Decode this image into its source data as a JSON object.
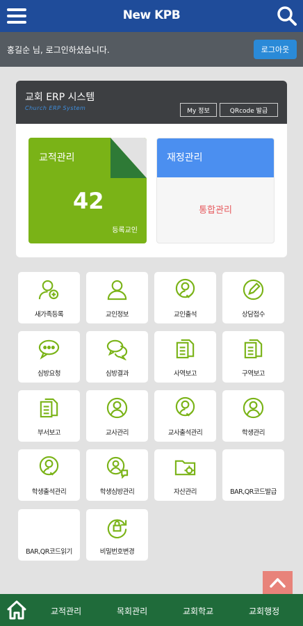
{
  "header": {
    "title": "New KPB",
    "menu_icon": "hamburger-menu-icon",
    "search_icon": "search-icon"
  },
  "userbar": {
    "welcome": "홍길순 님, 로그인하셨습니다.",
    "logout": "로그아웃"
  },
  "erp": {
    "title": "교회 ERP 시스템",
    "subtitle": "Church ERP System",
    "myinfo": "My 정보",
    "qr": "QRcode 발급",
    "members_tile": {
      "label": "교적관리",
      "count": "42",
      "caption": "등록교인"
    },
    "finance_tile": {
      "label": "재정관리",
      "link": "통합관리"
    }
  },
  "colors": {
    "primary": "#1f4c9a",
    "accent_green": "#7ab317",
    "icon_green": "#7ab317",
    "nav_green": "#1f6b3a",
    "finance_blue": "#4b8ff0"
  },
  "menu": [
    {
      "label": "새가족등록",
      "icon": "user-add-icon"
    },
    {
      "label": "교인정보",
      "icon": "user-icon"
    },
    {
      "label": "교인출석",
      "icon": "user-check-icon"
    },
    {
      "label": "상담접수",
      "icon": "pencil-icon"
    },
    {
      "label": "심방요청",
      "icon": "chat-bubble-icon"
    },
    {
      "label": "심방결과",
      "icon": "chat-bubbles-icon"
    },
    {
      "label": "사역보고",
      "icon": "documents-icon"
    },
    {
      "label": "구역보고",
      "icon": "documents-icon"
    },
    {
      "label": "부서보고",
      "icon": "documents-icon"
    },
    {
      "label": "교사관리",
      "icon": "user-circle-icon"
    },
    {
      "label": "교사출석관리",
      "icon": "user-check-icon"
    },
    {
      "label": "학생관리",
      "icon": "user-circle-icon"
    },
    {
      "label": "학생출석관리",
      "icon": "user-check-icon"
    },
    {
      "label": "학생심방관리",
      "icon": "user-chat-icon"
    },
    {
      "label": "자산관리",
      "icon": "folder-gear-icon"
    },
    {
      "label": "BAR,QR코드발급",
      "icon": ""
    },
    {
      "label": "BAR,QR코드읽기",
      "icon": ""
    },
    {
      "label": "비밀번호변경",
      "icon": "lock-refresh-icon"
    }
  ],
  "bottom_nav": {
    "home_icon": "home-icon",
    "items": [
      "교적관리",
      "목회관리",
      "교회학교",
      "교회행정"
    ]
  },
  "scroll_top_icon": "chevron-up-icon"
}
